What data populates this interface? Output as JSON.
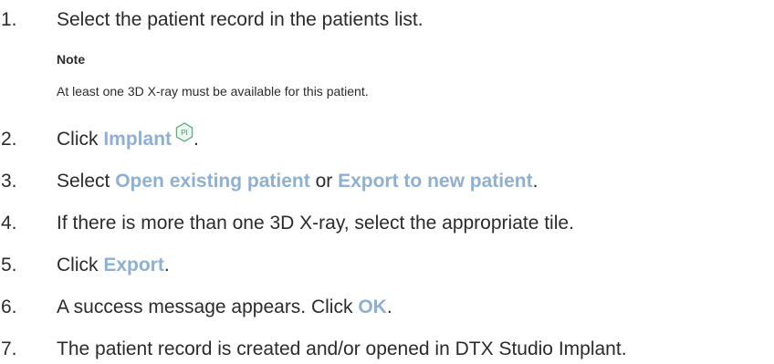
{
  "steps": [
    {
      "num": "1.",
      "text": "Select the patient record in the patients list."
    },
    {
      "num": "2.",
      "pre": "Click ",
      "ui": "Implant",
      "post": "."
    },
    {
      "num": "3.",
      "pre": "Select ",
      "ui1": "Open existing patient",
      "mid": " or ",
      "ui2": "Export to new patient",
      "post": "."
    },
    {
      "num": "4.",
      "text": "If there is more than one 3D X-ray, select the appropriate tile."
    },
    {
      "num": "5.",
      "pre": "Click ",
      "ui": "Export",
      "post": "."
    },
    {
      "num": "6.",
      "pre": "A success message appears. Click ",
      "ui": "OK",
      "post": "."
    },
    {
      "num": "7.",
      "text": "The patient record is created and/or opened in DTX Studio Implant."
    }
  ],
  "note": {
    "title": "Note",
    "text": "At least one 3D X-ray must be available for this patient."
  },
  "icons": {
    "implant": {
      "name": "implant-pi-icon",
      "label": "PI",
      "color": "#5fae7e"
    }
  },
  "colors": {
    "ui_reference": "#8eb0d3",
    "text": "#2b2b2b"
  }
}
